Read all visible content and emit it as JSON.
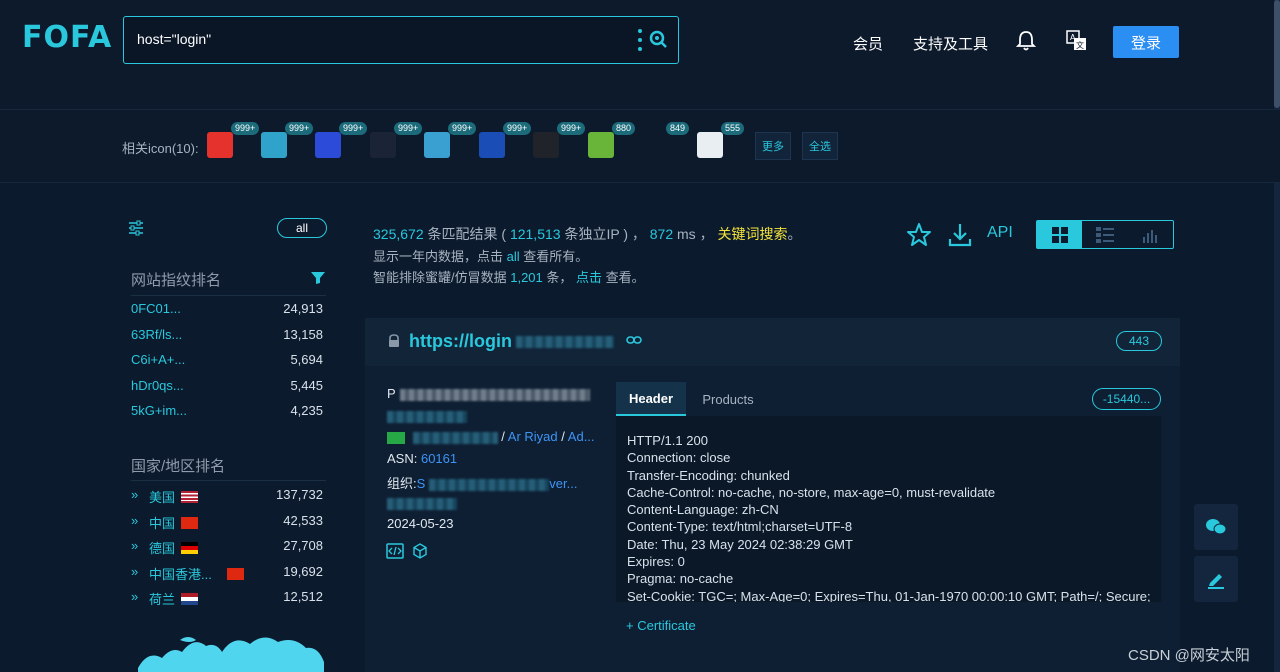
{
  "header": {
    "logo": "FOFA",
    "search_value": "host=\"login\"",
    "nav": [
      "会员",
      "支持及工具"
    ],
    "login_label": "登录"
  },
  "icon_bar": {
    "label": "相关icon(10):",
    "icons": [
      {
        "name": "oracle-icon",
        "count": "999+",
        "bg": "#e5322d"
      },
      {
        "name": "router-icon",
        "count": "999+",
        "bg": "#2fa3c9"
      },
      {
        "name": "baidu-paw-icon",
        "count": "999+",
        "bg": "#2b4bd8"
      },
      {
        "name": "bird-icon",
        "count": "999+",
        "bg": "#1a2436"
      },
      {
        "name": "cloud-eye-icon",
        "count": "999+",
        "bg": "#3aa0d2"
      },
      {
        "name": "ring-icon",
        "count": "999+",
        "bg": "#1a4db5"
      },
      {
        "name": "vmware-icon",
        "count": "999+",
        "bg": "#20242a"
      },
      {
        "name": "green-b-icon",
        "count": "880",
        "bg": "#68b53a"
      },
      {
        "name": "xh-icon",
        "count": "849",
        "bg": "#0c1a2c"
      },
      {
        "name": "document-icon",
        "count": "555",
        "bg": "#e9eef3"
      }
    ],
    "more_label": "更多",
    "select_all_label": "全选"
  },
  "sidebar": {
    "all_label": "all",
    "fingerprint_title": "网站指纹排名",
    "fingerprints": [
      {
        "name": "0FC01...",
        "count": "24,913"
      },
      {
        "name": "63Rf/ls...",
        "count": "13,158"
      },
      {
        "name": "C6i+A+...",
        "count": "5,694"
      },
      {
        "name": "hDr0qs...",
        "count": "5,445"
      },
      {
        "name": "5kG+im...",
        "count": "4,235"
      }
    ],
    "country_title": "国家/地区排名",
    "countries": [
      {
        "name": "美国",
        "count": "137,732",
        "flag": "us"
      },
      {
        "name": "中国",
        "count": "42,533",
        "flag": "cn"
      },
      {
        "name": "德国",
        "count": "27,708",
        "flag": "de"
      },
      {
        "name": "中国香港...",
        "count": "19,692",
        "flag": "hk"
      },
      {
        "name": "荷兰",
        "count": "12,512",
        "flag": "nl"
      }
    ]
  },
  "stats": {
    "total": "325,672",
    "total_suffix": " 条匹配结果 ( ",
    "unique_ip": "121,513",
    "ip_suffix": " 条独立IP ) ， ",
    "time": "872",
    "time_suffix": " ms ， ",
    "keyword_search": "关键词搜索",
    "keyword_tail": "。",
    "line2_prefix": "显示一年内数据，点击 ",
    "line2_link": "all",
    "line2_suffix": " 查看所有。",
    "line3_prefix": "智能排除蜜罐/仿冒数据 ",
    "line3_count": "1,201",
    "line3_mid": " 条， ",
    "line3_link": "点击",
    "line3_suffix": " 查看。",
    "api_label": "API"
  },
  "result": {
    "url": "https://login",
    "port": "443",
    "title_line": "P",
    "location_city": "Ar Riyad",
    "location_sep": "/",
    "location_more": "Ad...",
    "asn_label": "ASN:",
    "asn_value": "60161",
    "org_label": "组织:",
    "org_value": "S",
    "org_tail": "ver...",
    "date": "2024-05-23",
    "tab_header": "Header",
    "tab_products": "Products",
    "hash": "-15440...",
    "header_lines": [
      "HTTP/1.1 200",
      "Connection: close",
      "Transfer-Encoding: chunked",
      "Cache-Control: no-cache, no-store, max-age=0, must-revalidate",
      "Content-Language: zh-CN",
      "Content-Type: text/html;charset=UTF-8",
      "Date: Thu, 23 May 2024 02:38:29 GMT",
      "Expires: 0",
      "Pragma: no-cache",
      "Set-Cookie: TGC=; Max-Age=0; Expires=Thu, 01-Jan-1970 00:00:10 GMT; Path=/; Secure;"
    ],
    "certificate_label": "+ Certificate"
  },
  "watermark": "CSDN @网安太阳"
}
